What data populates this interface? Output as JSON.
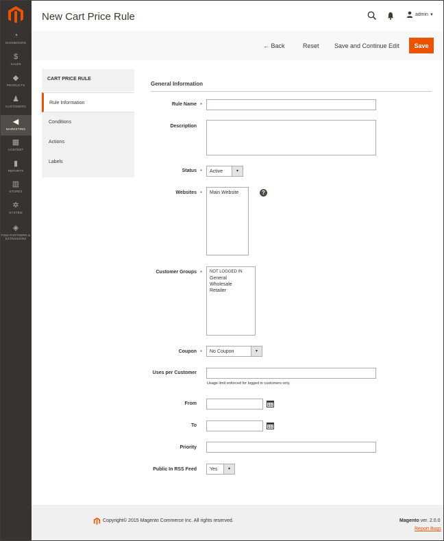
{
  "sidebar": {
    "items": [
      {
        "label": "DASHBOARD",
        "icon": "dashboard-icon",
        "glyph": "◔",
        "active": false
      },
      {
        "label": "SALES",
        "icon": "dollar-icon",
        "glyph": "$",
        "active": false
      },
      {
        "label": "PRODUCTS",
        "icon": "cube-icon",
        "glyph": "◆",
        "active": false
      },
      {
        "label": "CUSTOMERS",
        "icon": "person-icon",
        "glyph": "♟",
        "active": false
      },
      {
        "label": "MARKETING",
        "icon": "megaphone-icon",
        "glyph": "◀",
        "active": true
      },
      {
        "label": "CONTENT",
        "icon": "layout-icon",
        "glyph": "▦",
        "active": false
      },
      {
        "label": "REPORTS",
        "icon": "bar-chart-icon",
        "glyph": "▮",
        "active": false
      },
      {
        "label": "STORES",
        "icon": "store-icon",
        "glyph": "▥",
        "active": false
      },
      {
        "label": "SYSTEM",
        "icon": "gear-icon",
        "glyph": "✲",
        "active": false
      },
      {
        "label": "FIND PARTNERS & EXTENSIONS",
        "icon": "box-icon",
        "glyph": "◈",
        "active": false
      }
    ]
  },
  "header": {
    "title": "New Cart Price Rule",
    "user": "admin"
  },
  "actions": {
    "back": "← Back",
    "reset": "Reset",
    "save_continue": "Save and Continue Edit",
    "save": "Save"
  },
  "tabs": {
    "heading": "CART PRICE RULE",
    "items": [
      "Rule Information",
      "Conditions",
      "Actions",
      "Labels"
    ]
  },
  "form": {
    "section_title": "General Information",
    "rule_name": {
      "label": "Rule Name",
      "value": ""
    },
    "description": {
      "label": "Description",
      "value": ""
    },
    "status": {
      "label": "Status",
      "value": "Active"
    },
    "websites": {
      "label": "Websites",
      "options": [
        "Main Website"
      ]
    },
    "customer_groups": {
      "label": "Customer Groups",
      "options": [
        "NOT LOGGED IN",
        "General",
        "Wholesale",
        "Retailer"
      ]
    },
    "coupon": {
      "label": "Coupon",
      "value": "No Coupon"
    },
    "uses_per_customer": {
      "label": "Uses per Customer",
      "value": "",
      "note": "Usage limit enforced for logged in customers only."
    },
    "from": {
      "label": "From",
      "value": ""
    },
    "to": {
      "label": "To",
      "value": ""
    },
    "priority": {
      "label": "Priority",
      "value": ""
    },
    "public_rss": {
      "label": "Public In RSS Feed",
      "value": "Yes"
    }
  },
  "footer": {
    "copyright": "Copyright© 2015 Magento Commerce Inc. All rights reserved.",
    "brand": "Magento",
    "version": " ver. 2.0.0",
    "report_bugs": "Report Bugs"
  },
  "colors": {
    "accent": "#eb5202",
    "sidebar_bg": "#373330",
    "required": "#e22626"
  }
}
